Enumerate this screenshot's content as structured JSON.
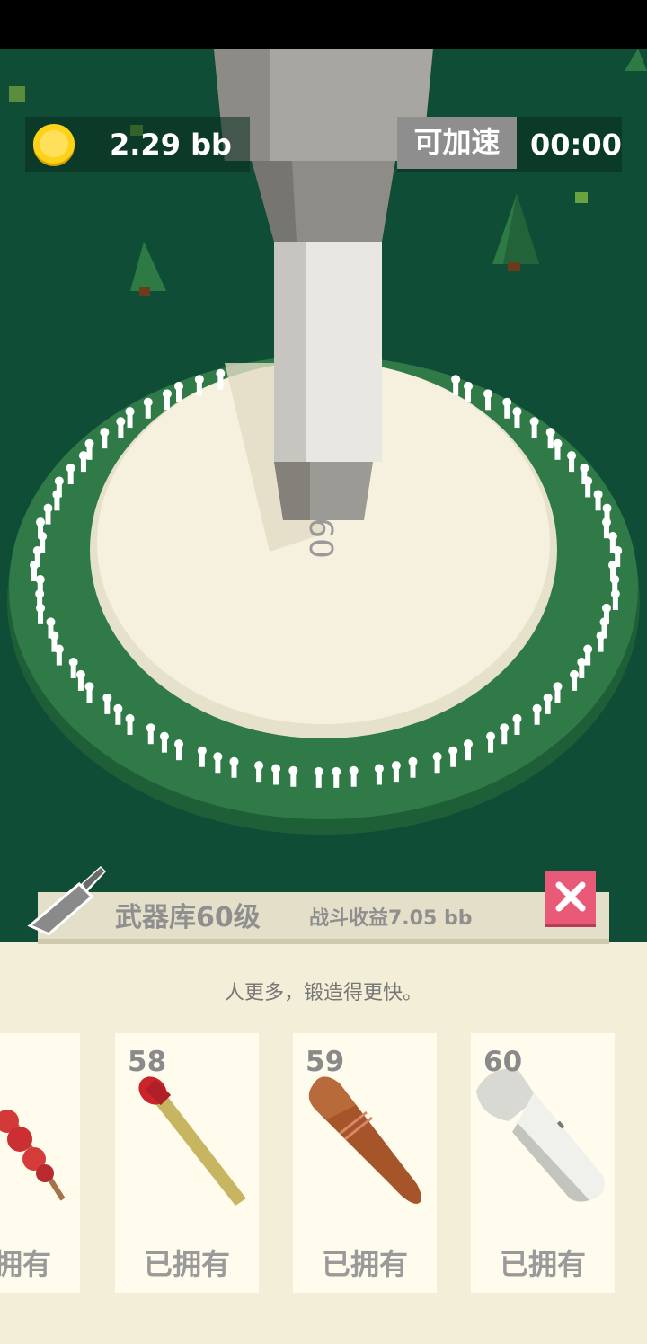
{
  "hud": {
    "coin_amount": "2.29 bb",
    "speed_label": "可加速",
    "timer": "00:00"
  },
  "scene": {
    "engraved_number": "60"
  },
  "armory": {
    "title": "武器库60级",
    "earnings": "战斗收益7.05 bb",
    "hint": "人更多，锻造得更快。",
    "items": [
      {
        "level": "",
        "status": "已拥有",
        "icon": "candied-haws-icon"
      },
      {
        "level": "58",
        "status": "已拥有",
        "icon": "match-icon"
      },
      {
        "level": "59",
        "status": "已拥有",
        "icon": "bullet-icon"
      },
      {
        "level": "60",
        "status": "已拥有",
        "icon": "flashlight-icon"
      }
    ]
  },
  "colors": {
    "ground": "#0f4d36",
    "ring": "#2f7a46",
    "platform": "#f6f1de",
    "close_button": "#e95a78",
    "panel": "#f3eed8"
  }
}
